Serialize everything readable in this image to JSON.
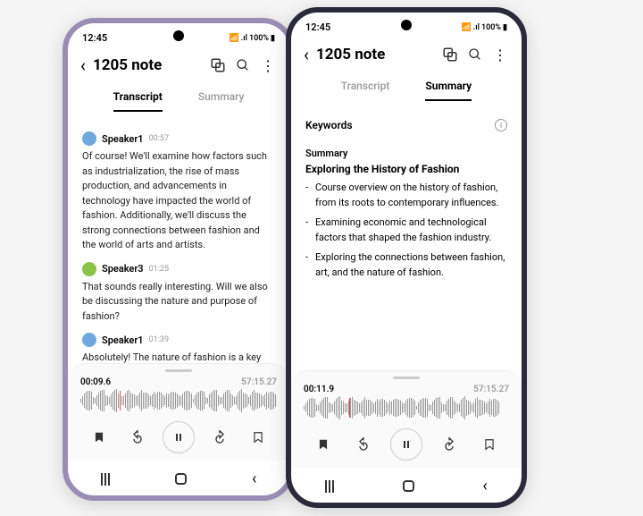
{
  "statusBar": {
    "time": "12:45",
    "signal": "100%"
  },
  "header": {
    "title": "1205 note"
  },
  "tabs": {
    "transcript": "Transcript",
    "summary": "Summary"
  },
  "transcript": [
    {
      "speaker": "Speaker1",
      "avatar": "blue",
      "time": "00:57",
      "text": "Of course! We'll examine how factors such as industrialization, the rise of mass production, and advancements in technology have impacted the world of fashion. Additionally, we'll discuss the strong connections between fashion and the world of arts and artists."
    },
    {
      "speaker": "Speaker3",
      "avatar": "green",
      "time": "01:25",
      "text": "That sounds really interesting. Will we also be discussing the nature and purpose of fashion?"
    },
    {
      "speaker": "Speaker1",
      "avatar": "blue",
      "time": "01:39",
      "text": "Absolutely! The nature of fashion is a key topic we'll be exploring."
    }
  ],
  "summary": {
    "keywordsLabel": "Keywords",
    "sectionLabel": "Summary",
    "title": "Exploring the History of Fashion",
    "bullets": [
      "Course overview on the history of fashion, from its roots to contemporary influences.",
      "Examining economic and technological factors that shaped the fashion industry.",
      "Exploring the connections between fashion, art, and the nature of fashion."
    ]
  },
  "player": {
    "left": {
      "current": "00:09.6",
      "total": "57:15.27"
    },
    "right": {
      "current": "00:11.9",
      "total": "57:15.27"
    }
  }
}
